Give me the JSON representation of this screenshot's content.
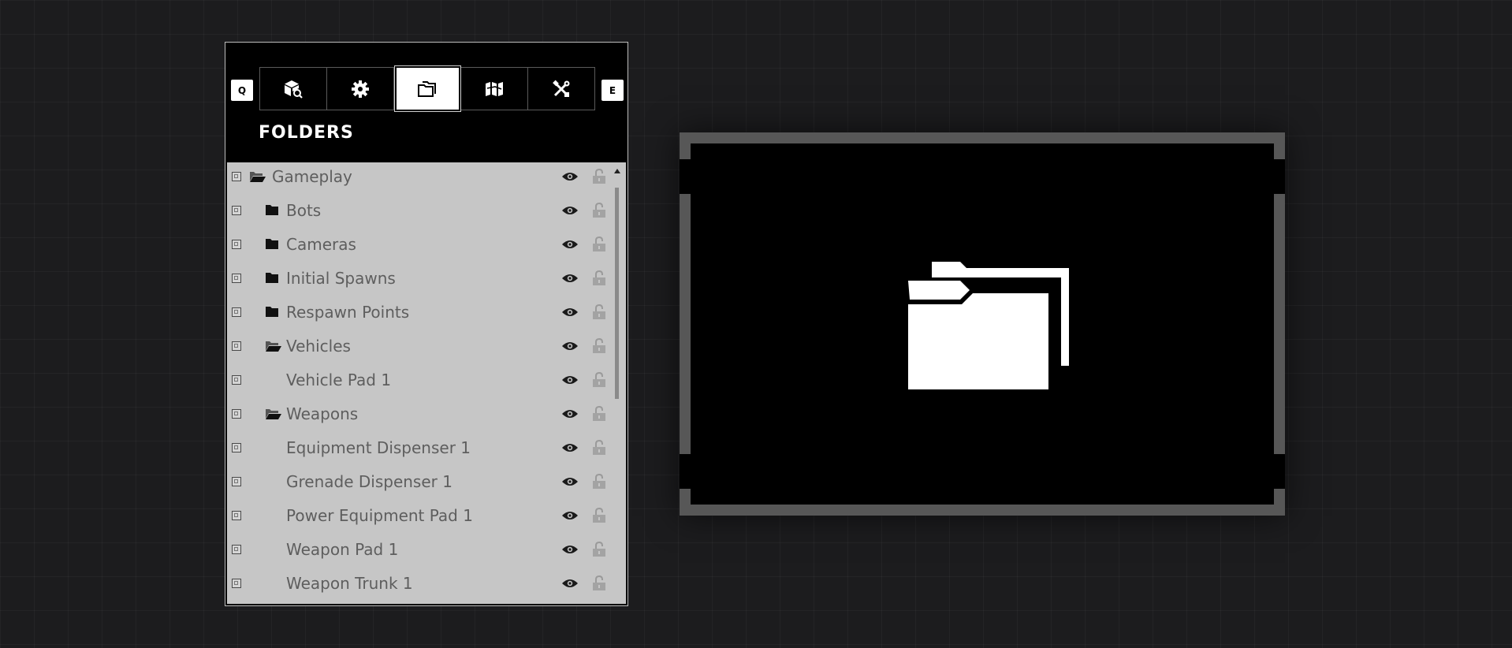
{
  "panel": {
    "title": "FOLDERS",
    "key_left": "Q",
    "key_right": "E",
    "tabs": [
      {
        "icon": "object-browser-icon",
        "active": false
      },
      {
        "icon": "settings-icon",
        "active": false
      },
      {
        "icon": "folder-icon",
        "active": true
      },
      {
        "icon": "map-icon",
        "active": false
      },
      {
        "icon": "tools-icon",
        "active": false
      }
    ]
  },
  "tree": {
    "items": [
      {
        "label": "Gameplay",
        "level": 0,
        "icon": "folder-open-icon"
      },
      {
        "label": "Bots",
        "level": 1,
        "icon": "folder-closed-icon"
      },
      {
        "label": "Cameras",
        "level": 1,
        "icon": "folder-closed-icon"
      },
      {
        "label": "Initial Spawns",
        "level": 1,
        "icon": "folder-closed-icon"
      },
      {
        "label": "Respawn Points",
        "level": 1,
        "icon": "folder-closed-icon"
      },
      {
        "label": "Vehicles",
        "level": 1,
        "icon": "folder-open-icon"
      },
      {
        "label": "Vehicle Pad 1",
        "level": 2,
        "icon": ""
      },
      {
        "label": "Weapons",
        "level": 1,
        "icon": "folder-open-icon"
      },
      {
        "label": "Equipment Dispenser 1",
        "level": 2,
        "icon": ""
      },
      {
        "label": "Grenade Dispenser 1",
        "level": 2,
        "icon": ""
      },
      {
        "label": "Power Equipment Pad 1",
        "level": 2,
        "icon": ""
      },
      {
        "label": "Weapon Pad 1",
        "level": 2,
        "icon": ""
      },
      {
        "label": "Weapon Trunk 1",
        "level": 2,
        "icon": ""
      }
    ]
  },
  "preview": {
    "icon": "folder-icon"
  }
}
